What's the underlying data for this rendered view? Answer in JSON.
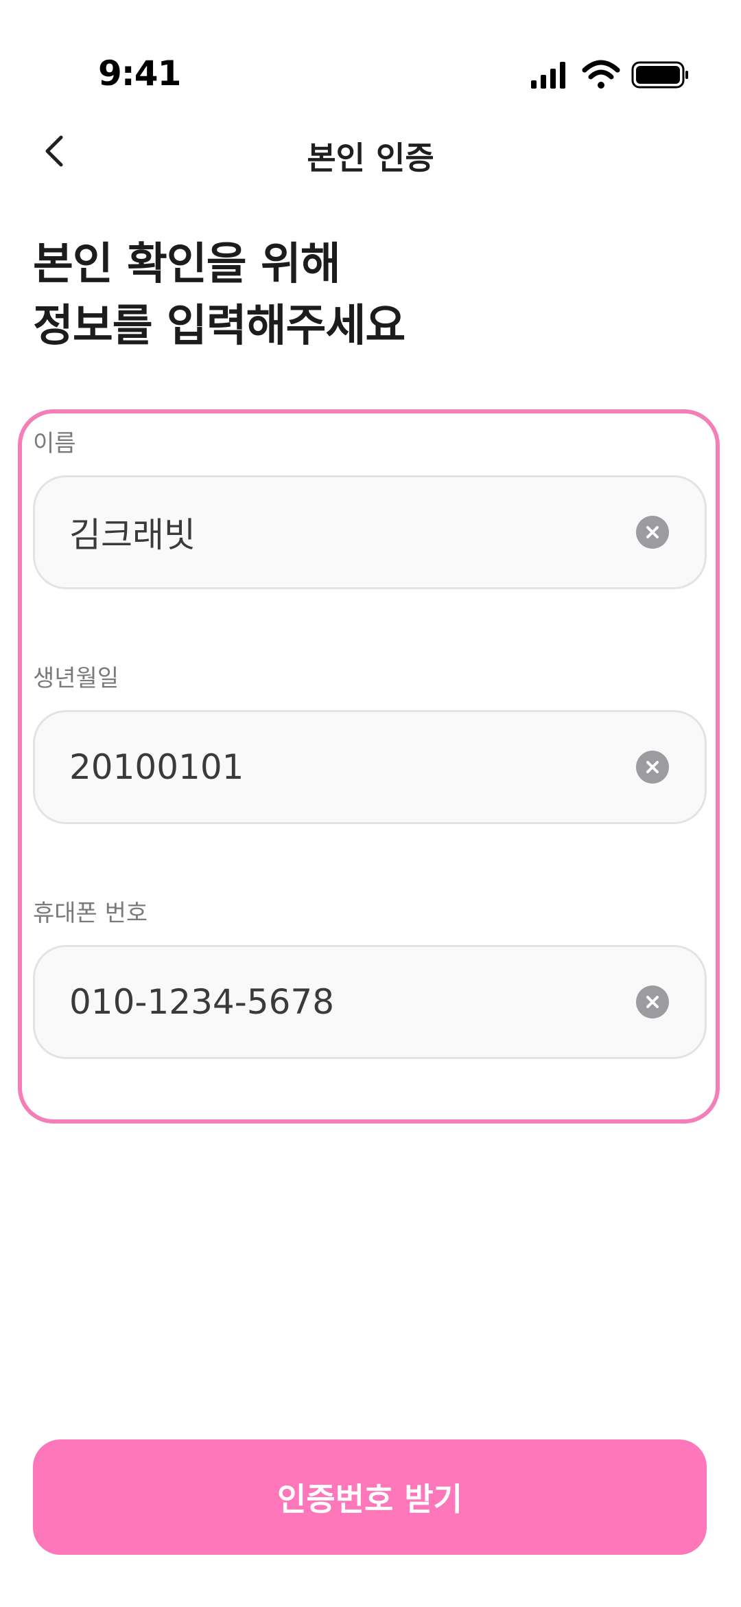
{
  "status_bar": {
    "time": "9:41",
    "icons": [
      "signal-icon",
      "wifi-icon",
      "battery-icon"
    ]
  },
  "nav": {
    "title": "본인 인증",
    "back_icon": "chevron-left-icon"
  },
  "heading": {
    "line1": "본인 확인을 위해",
    "line2": "정보를 입력해주세요"
  },
  "form": {
    "highlight_color": "#f47eb8",
    "fields": [
      {
        "label": "이름",
        "value": "김크래빗"
      },
      {
        "label": "생년월일",
        "value": "20100101"
      },
      {
        "label": "휴대폰 번호",
        "value": "010-1234-5678"
      }
    ],
    "clear_icon": "clear-circle-icon"
  },
  "cta": {
    "label": "인증번호 받기",
    "color": "#ff77bb"
  }
}
